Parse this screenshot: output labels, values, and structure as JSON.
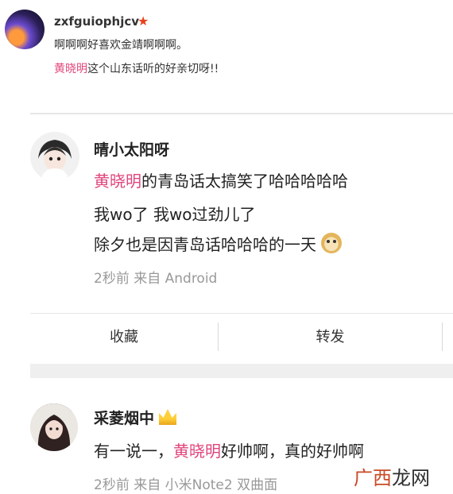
{
  "post1": {
    "username": "zxfguiophjcv",
    "badge_icon": "red-star-badge-icon",
    "line1": "啊啊啊好喜欢金靖啊啊啊。",
    "line2_mention": "黄晓明",
    "line2_rest": "这个山东话听的好亲切呀!!"
  },
  "card": {
    "username": "晴小太阳呀",
    "text_line1_mention": "黄晓明",
    "text_line1_rest": "的青岛话太搞笑了哈哈哈哈哈",
    "text_line2": "我wo了 我wo过劲儿了",
    "text_line3": "除夕也是因青岛话哈哈哈的一天",
    "emoji_icon": "doge-emoji-icon",
    "meta": "2秒前  来自 Android",
    "actions": {
      "collect": "收藏",
      "forward": "转发"
    }
  },
  "post3": {
    "username": "采菱烟中",
    "crown_icon": "gold-crown-icon",
    "text_prefix": "有一说一，",
    "text_mention": "黄晓明",
    "text_suffix": "好帅啊，真的好帅啊",
    "meta": "2秒前  来自 小米Note2 双曲面"
  },
  "watermark": {
    "part1": "广西",
    "part2": "龙网"
  },
  "colors": {
    "mention": "#e0457b",
    "meta_gray": "#999999",
    "badge_red": "#e8401c"
  }
}
